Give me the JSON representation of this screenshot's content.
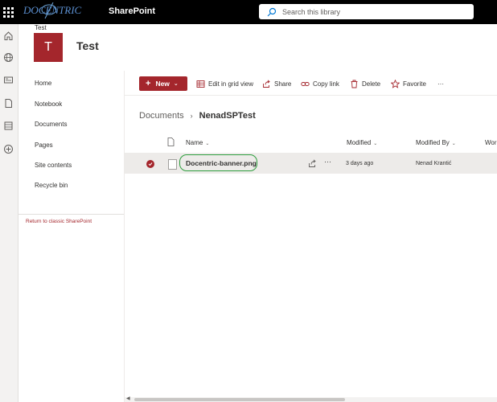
{
  "suite": {
    "app_name": "SharePoint",
    "brand_logo_text": "DOCENTRIC",
    "search_placeholder": "Search this library"
  },
  "rail": {
    "icons": [
      "home-icon",
      "globe-icon",
      "news-icon",
      "document-icon",
      "lists-icon",
      "add-icon"
    ]
  },
  "site": {
    "breadcrumb": "Test",
    "logo_letter": "T",
    "title": "Test",
    "brand_color": "#a4262c"
  },
  "nav": {
    "items": [
      {
        "label": "Home"
      },
      {
        "label": "Notebook"
      },
      {
        "label": "Documents"
      },
      {
        "label": "Pages"
      },
      {
        "label": "Site contents"
      },
      {
        "label": "Recycle bin"
      }
    ],
    "return_link": "Return to classic SharePoint"
  },
  "commands": {
    "new_label": "New",
    "edit_grid": "Edit in grid view",
    "share": "Share",
    "copy_link": "Copy link",
    "delete": "Delete",
    "favorite": "Favorite",
    "more": "···"
  },
  "breadcrumb": {
    "root": "Documents",
    "separator": "›",
    "current": "NenadSPTest"
  },
  "table": {
    "columns": {
      "name": "Name",
      "modified": "Modified",
      "modified_by": "Modified By",
      "workflow": "Wor"
    },
    "rows": [
      {
        "name": "Docentric-banner.png",
        "modified": "3 days ago",
        "modified_by": "Nenad Krantić",
        "selected": true,
        "more": "···"
      }
    ]
  },
  "colors": {
    "accent": "#a4262c",
    "highlight_ring": "#2e9e3e"
  }
}
